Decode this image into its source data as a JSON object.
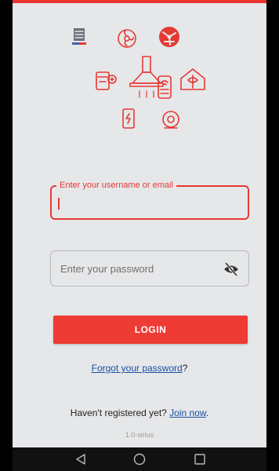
{
  "colors": {
    "accent": "#ee3b34",
    "link": "#1a4fa3",
    "background": "#e6e7e9",
    "navbar": "#111111"
  },
  "hero": {
    "icons": [
      "brand-logo-icon",
      "fan-icon",
      "ceiling-fan-icon",
      "kettle-icon",
      "chimney-hood-icon",
      "smart-plug-icon",
      "smart-home-icon",
      "smartphone-icon",
      "sensor-icon"
    ]
  },
  "login": {
    "username_label": "Enter your username or email",
    "username_value": "",
    "password_placeholder": "Enter your password",
    "password_icon": "eye-off-icon",
    "button_label": "LOGIN"
  },
  "links": {
    "forgot_text": "Forgot your password",
    "forgot_suffix": "?",
    "register_prefix": "Haven't registered yet? ",
    "register_link": "Join now",
    "register_suffix": "."
  },
  "version": "1.0-sirius",
  "navbar": {
    "icons": [
      "back-icon",
      "home-icon",
      "recents-icon"
    ]
  }
}
